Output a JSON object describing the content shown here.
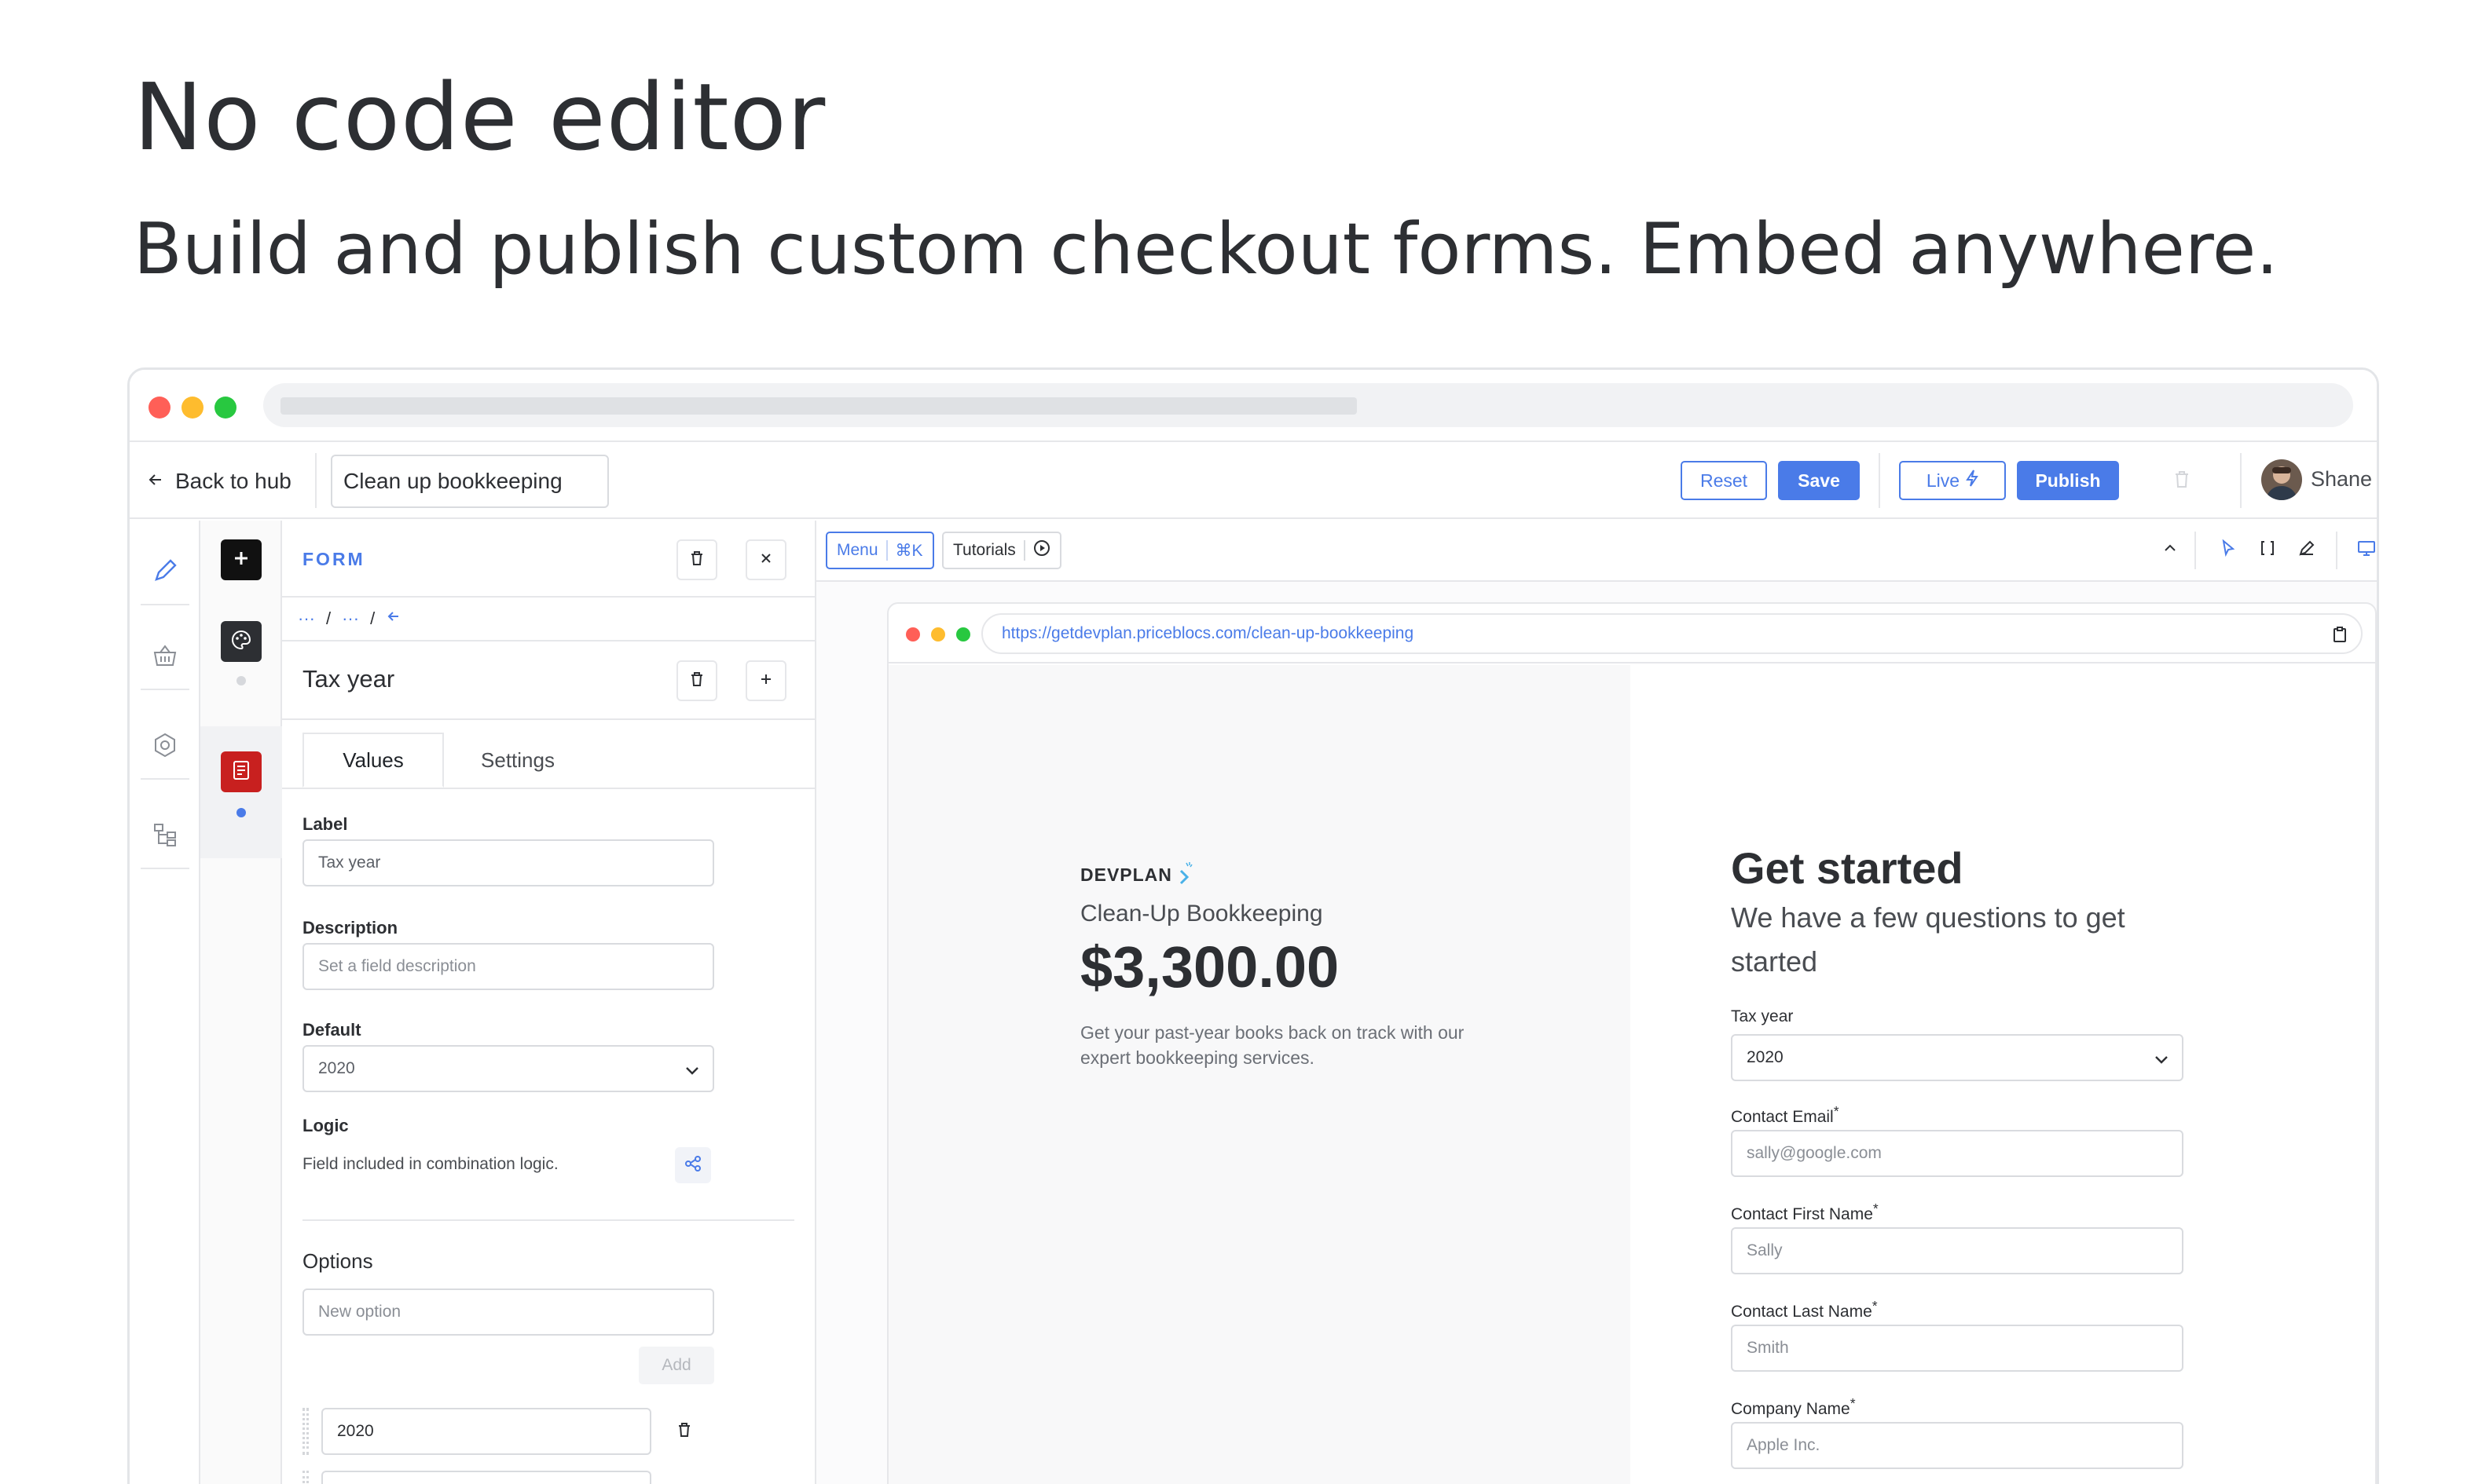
{
  "hero": {
    "title": "No code editor",
    "subtitle": "Build and publish custom checkout forms. Embed anywhere."
  },
  "colors": {
    "accent": "#4a7be8",
    "traffic_red": "#ff5f57",
    "traffic_yellow": "#febc2e",
    "traffic_green": "#28c840",
    "form_tile_red": "#c8201f"
  },
  "appbar": {
    "back_label": "Back to hub",
    "doc_name": "Clean up bookkeeping",
    "reset_label": "Reset",
    "save_label": "Save",
    "live_label": "Live",
    "publish_label": "Publish",
    "user_name": "Shane"
  },
  "panel": {
    "section_title": "FORM",
    "breadcrumb": [
      "···",
      "/",
      "···",
      "/"
    ],
    "field_title": "Tax year",
    "tabs": [
      {
        "label": "Values",
        "active": true
      },
      {
        "label": "Settings",
        "active": false
      }
    ],
    "label_label": "Label",
    "label_value": "Tax year",
    "description_label": "Description",
    "description_placeholder": "Set a field description",
    "default_label": "Default",
    "default_value": "2020",
    "logic_label": "Logic",
    "logic_text": "Field included in combination logic.",
    "options_title": "Options",
    "new_option_placeholder": "New option",
    "add_label": "Add",
    "options": [
      "2020"
    ]
  },
  "canvas": {
    "menu_label": "Menu",
    "menu_shortcut": "⌘K",
    "tutorials_label": "Tutorials"
  },
  "preview": {
    "url": "https://getdevplan.priceblocs.com/clean-up-bookkeeping",
    "brand": "DEVPLAN",
    "product_name": "Clean-Up Bookkeeping",
    "price": "$3,300.00",
    "product_desc_line1": "Get your past-year books back on track with our",
    "product_desc_line2": "expert bookkeeping services.",
    "form_title": "Get started",
    "form_subtitle_line1": "We have a few questions to get",
    "form_subtitle_line2": "started",
    "fields": [
      {
        "label": "Tax year",
        "required": false,
        "value": "2020",
        "type": "select"
      },
      {
        "label": "Contact Email",
        "required": true,
        "placeholder": "sally@google.com",
        "type": "text"
      },
      {
        "label": "Contact First Name",
        "required": true,
        "placeholder": "Sally",
        "type": "text"
      },
      {
        "label": "Contact Last Name",
        "required": true,
        "placeholder": "Smith",
        "type": "text"
      },
      {
        "label": "Company Name",
        "required": true,
        "placeholder": "Apple Inc.",
        "type": "text"
      }
    ],
    "required_mark": "*"
  }
}
